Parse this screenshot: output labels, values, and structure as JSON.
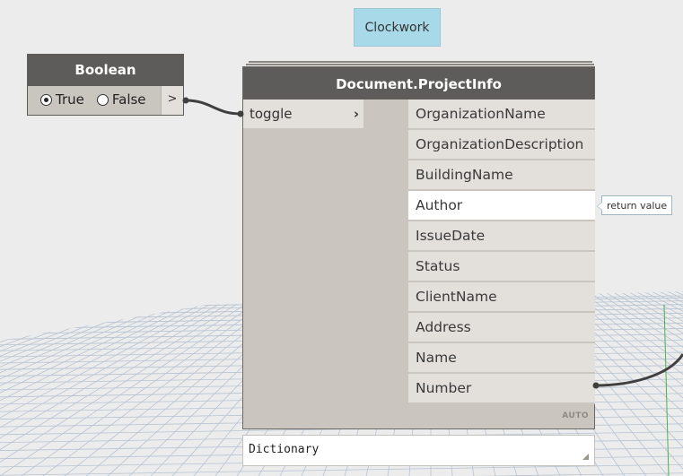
{
  "clockwork_group": {
    "label": "Clockwork"
  },
  "boolean_node": {
    "title": "Boolean",
    "options": [
      {
        "label": "True",
        "checked": true
      },
      {
        "label": "False",
        "checked": false
      }
    ],
    "output_label": ">"
  },
  "projectinfo_node": {
    "title": "Document.ProjectInfo",
    "input": {
      "label": "toggle",
      "chevron": "›"
    },
    "outputs": [
      "OrganizationName",
      "OrganizationDescription",
      "BuildingName",
      "Author",
      "IssueDate",
      "Status",
      "ClientName",
      "Address",
      "Name",
      "Number"
    ],
    "highlighted_output": "Author",
    "lacing": "AUTO",
    "tooltip": "return value",
    "preview_text": "Dictionary"
  },
  "colors": {
    "node_header": "#5e5c5a",
    "node_body": "#cac6bf",
    "port_bg": "#e3e0db",
    "group_bg": "#a8d9e8",
    "canvas_bg": "#ececec"
  }
}
